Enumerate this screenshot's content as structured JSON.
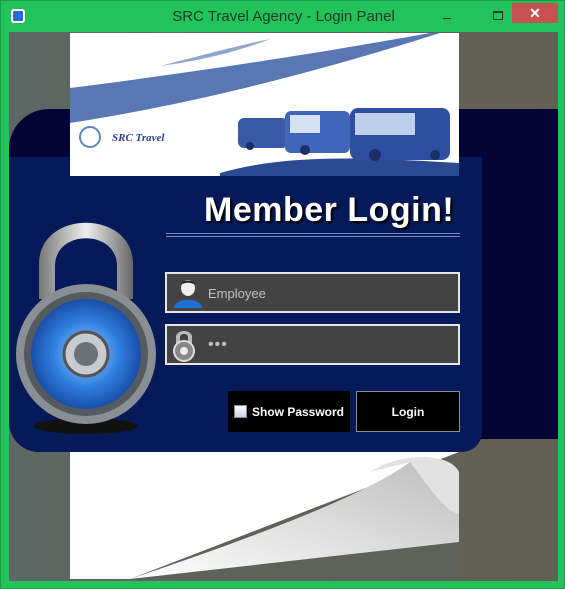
{
  "window": {
    "title": "SRC Travel Agency - Login Panel",
    "minimize": "‒",
    "close": "✕"
  },
  "banner": {
    "logo_text": "SRC Travel"
  },
  "form": {
    "heading": "Member Login!",
    "username": {
      "value": "Employee",
      "icon": "user-icon"
    },
    "password": {
      "value": "•••",
      "icon": "padlock-icon"
    },
    "show_password": {
      "label": "Show Password",
      "checked": false
    },
    "login_label": "Login"
  },
  "colors": {
    "frame": "#22c35a",
    "panel": "#061a5a",
    "field": "#434343",
    "close": "#c75050"
  }
}
